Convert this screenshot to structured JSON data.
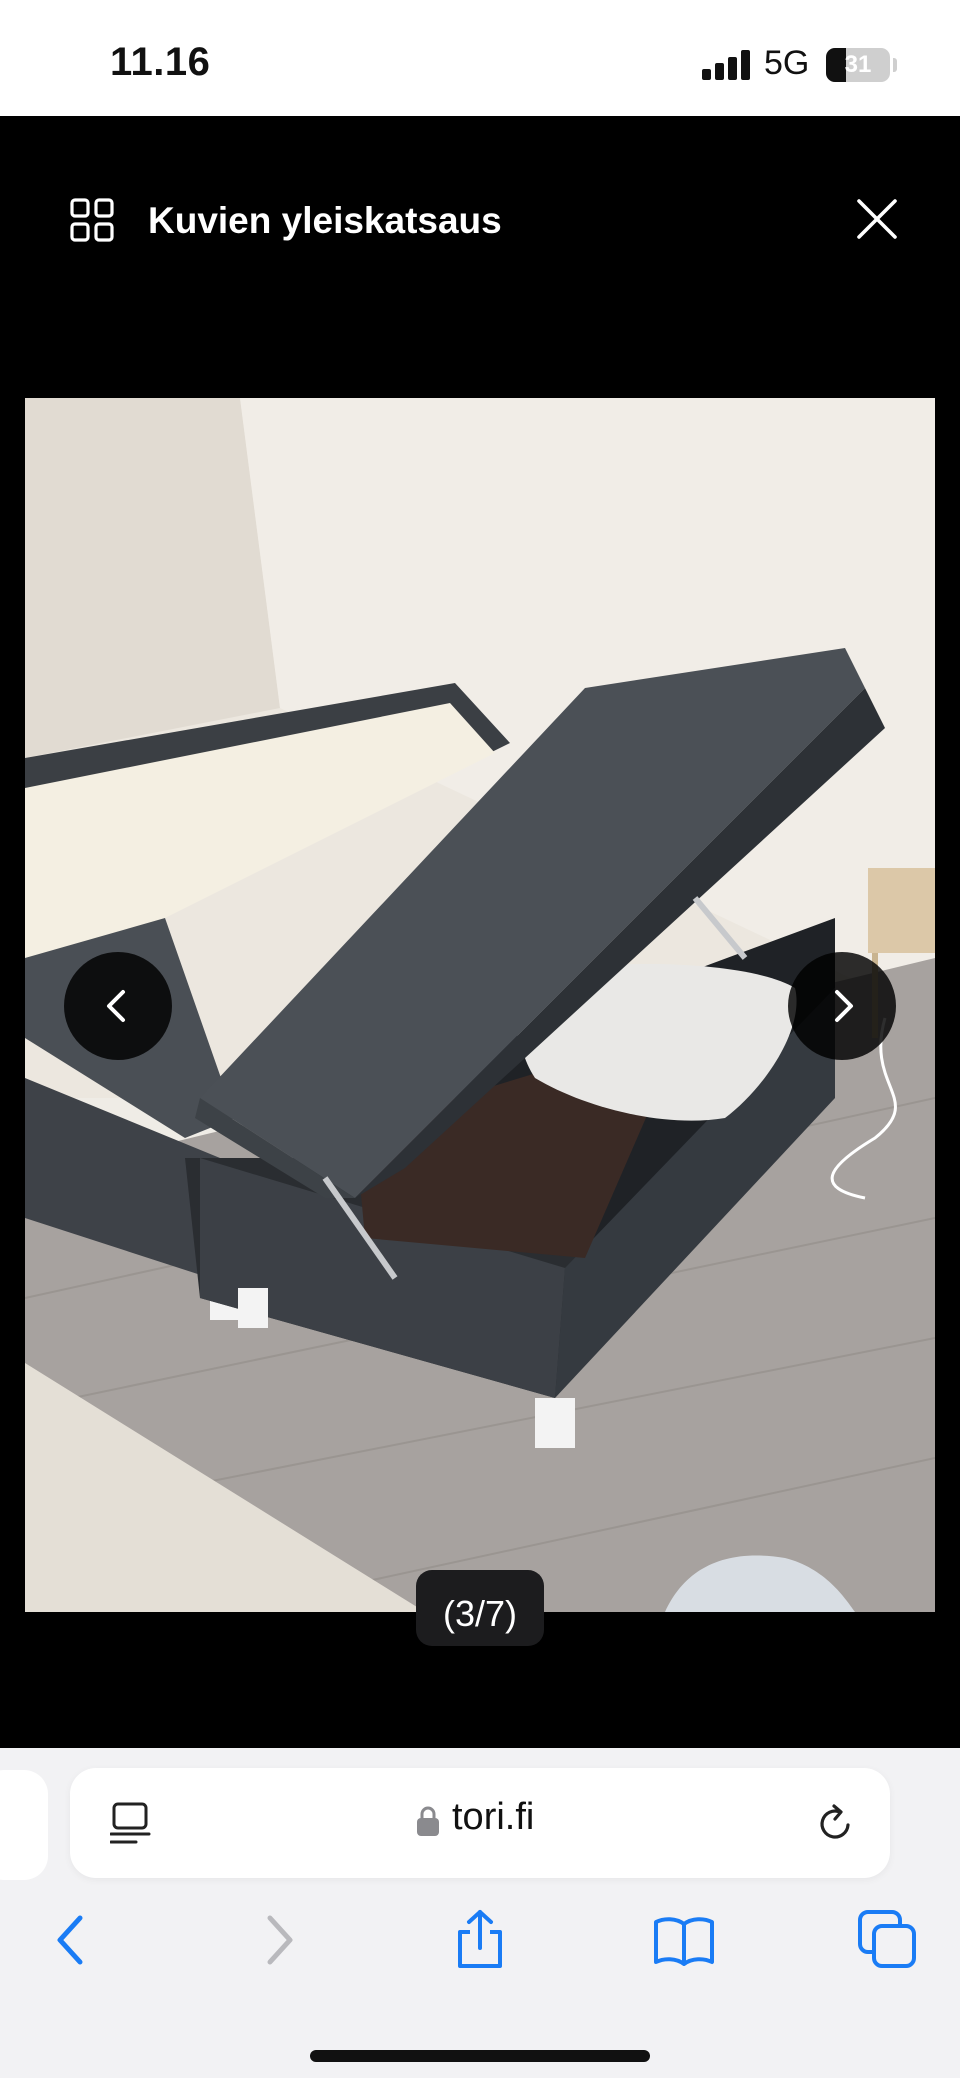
{
  "status_bar": {
    "time": "11.16",
    "network": "5G",
    "battery_percent": "31",
    "battery_level": 0.31,
    "signal_bars": 4
  },
  "viewer": {
    "overview_label": "Kuvien yleiskatsaus",
    "image_counter": "(3/7)",
    "icons": {
      "overview": "grid-icon",
      "close": "close-icon",
      "previous": "chevron-left-icon",
      "next": "chevron-right-icon"
    }
  },
  "browser": {
    "domain": "tori.fi",
    "secure": true,
    "icons": {
      "reader": "page-menu-icon",
      "lock": "lock-icon",
      "reload": "reload-icon",
      "back": "back-icon",
      "forward": "forward-icon",
      "share": "share-icon",
      "bookmarks": "bookmarks-icon",
      "tabs": "tabs-icon"
    },
    "accent_color": "#1a7cf5",
    "disabled_color": "#b9b9bd"
  }
}
